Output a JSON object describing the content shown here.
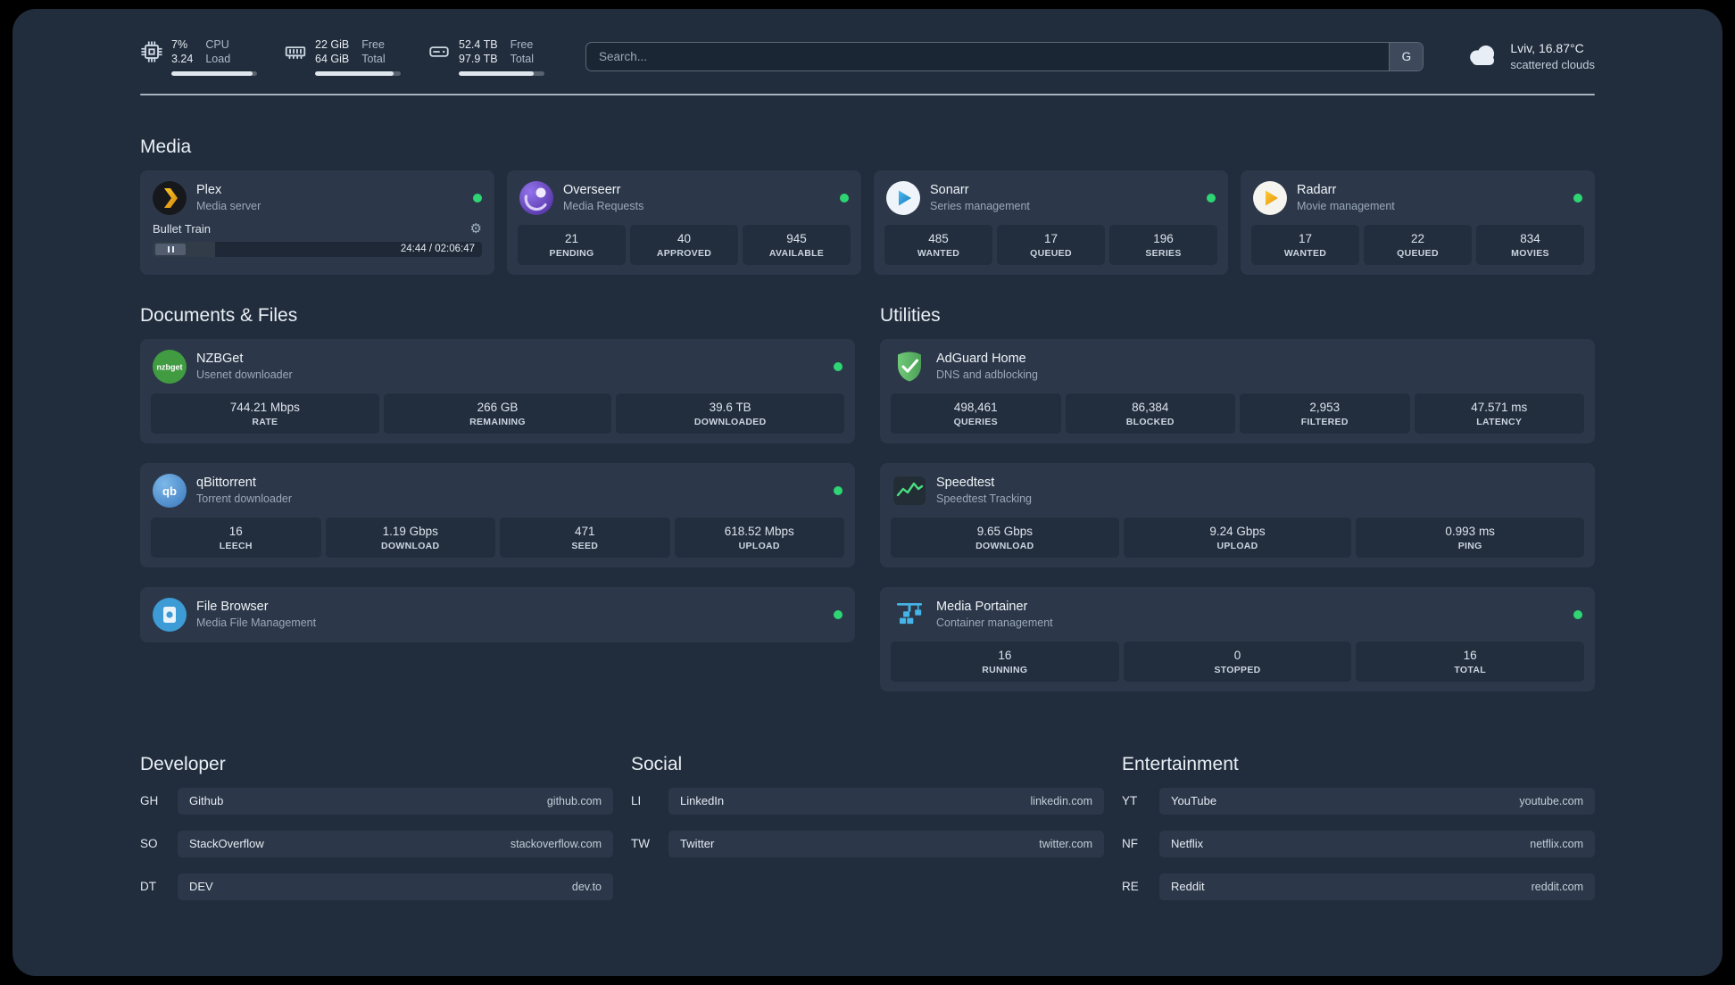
{
  "colors": {
    "status_online": "#2ed573",
    "plex_accent": "#e5a00d",
    "adguard_green": "#68bc71",
    "speedtest_line": "#4ade80"
  },
  "topbar": {
    "resources": [
      {
        "icon": "cpu-icon",
        "primary": "7%",
        "secondary": "3.24",
        "label_primary": "CPU",
        "label_secondary": "Load"
      },
      {
        "icon": "memory-icon",
        "primary": "22 GiB",
        "secondary": "64 GiB",
        "label_primary": "Free",
        "label_secondary": "Total"
      },
      {
        "icon": "disk-icon",
        "primary": "52.4 TB",
        "secondary": "97.9 TB",
        "label_primary": "Free",
        "label_secondary": "Total"
      }
    ],
    "search": {
      "placeholder": "Search...",
      "provider_button": "G"
    },
    "weather": {
      "icon": "cloud-icon",
      "location": "Lviv, 16.87°C",
      "condition": "scattered clouds"
    }
  },
  "sections": {
    "media": {
      "title": "Media",
      "cards": [
        {
          "name": "Plex",
          "subtitle": "Media server",
          "icon": "plex-icon",
          "online": true,
          "player": {
            "track": "Bullet Train",
            "time": "24:44 / 02:06:47",
            "controls": [
              "gear-icon",
              "pause-icon"
            ]
          }
        },
        {
          "name": "Overseerr",
          "subtitle": "Media Requests",
          "icon": "overseerr-icon",
          "online": true,
          "stats": [
            {
              "value": "21",
              "label": "PENDING"
            },
            {
              "value": "40",
              "label": "APPROVED"
            },
            {
              "value": "945",
              "label": "AVAILABLE"
            }
          ]
        },
        {
          "name": "Sonarr",
          "subtitle": "Series management",
          "icon": "sonarr-icon",
          "online": true,
          "stats": [
            {
              "value": "485",
              "label": "WANTED"
            },
            {
              "value": "17",
              "label": "QUEUED"
            },
            {
              "value": "196",
              "label": "SERIES"
            }
          ]
        },
        {
          "name": "Radarr",
          "subtitle": "Movie management",
          "icon": "radarr-icon",
          "online": true,
          "stats": [
            {
              "value": "17",
              "label": "WANTED"
            },
            {
              "value": "22",
              "label": "QUEUED"
            },
            {
              "value": "834",
              "label": "MOVIES"
            }
          ]
        }
      ]
    },
    "documents": {
      "title": "Documents & Files",
      "cards": [
        {
          "name": "NZBGet",
          "subtitle": "Usenet downloader",
          "icon": "nzbget-icon",
          "online": true,
          "stats": [
            {
              "value": "744.21 Mbps",
              "label": "RATE"
            },
            {
              "value": "266 GB",
              "label": "REMAINING"
            },
            {
              "value": "39.6 TB",
              "label": "DOWNLOADED"
            }
          ]
        },
        {
          "name": "qBittorrent",
          "subtitle": "Torrent downloader",
          "icon": "qbittorrent-icon",
          "online": true,
          "stats": [
            {
              "value": "16",
              "label": "LEECH"
            },
            {
              "value": "1.19 Gbps",
              "label": "DOWNLOAD"
            },
            {
              "value": "471",
              "label": "SEED"
            },
            {
              "value": "618.52 Mbps",
              "label": "UPLOAD"
            }
          ]
        },
        {
          "name": "File Browser",
          "subtitle": "Media File Management",
          "icon": "filebrowser-icon",
          "online": true,
          "stats": []
        }
      ]
    },
    "utilities": {
      "title": "Utilities",
      "cards": [
        {
          "name": "AdGuard Home",
          "subtitle": "DNS and adblocking",
          "icon": "adguard-icon",
          "online": false,
          "stats": [
            {
              "value": "498,461",
              "label": "QUERIES"
            },
            {
              "value": "86,384",
              "label": "BLOCKED"
            },
            {
              "value": "2,953",
              "label": "FILTERED"
            },
            {
              "value": "47.571 ms",
              "label": "LATENCY"
            }
          ]
        },
        {
          "name": "Speedtest",
          "subtitle": "Speedtest Tracking",
          "icon": "speedtest-icon",
          "online": false,
          "stats": [
            {
              "value": "9.65 Gbps",
              "label": "DOWNLOAD"
            },
            {
              "value": "9.24 Gbps",
              "label": "UPLOAD"
            },
            {
              "value": "0.993 ms",
              "label": "PING"
            }
          ]
        },
        {
          "name": "Media Portainer",
          "subtitle": "Container management",
          "icon": "portainer-icon",
          "online": true,
          "stats": [
            {
              "value": "16",
              "label": "RUNNING"
            },
            {
              "value": "0",
              "label": "STOPPED"
            },
            {
              "value": "16",
              "label": "TOTAL"
            }
          ]
        }
      ]
    }
  },
  "bookmarks": [
    {
      "title": "Developer",
      "items": [
        {
          "abbr": "GH",
          "name": "Github",
          "domain": "github.com"
        },
        {
          "abbr": "SO",
          "name": "StackOverflow",
          "domain": "stackoverflow.com"
        },
        {
          "abbr": "DT",
          "name": "DEV",
          "domain": "dev.to"
        }
      ]
    },
    {
      "title": "Social",
      "items": [
        {
          "abbr": "LI",
          "name": "LinkedIn",
          "domain": "linkedin.com"
        },
        {
          "abbr": "TW",
          "name": "Twitter",
          "domain": "twitter.com"
        }
      ]
    },
    {
      "title": "Entertainment",
      "items": [
        {
          "abbr": "YT",
          "name": "YouTube",
          "domain": "youtube.com"
        },
        {
          "abbr": "NF",
          "name": "Netflix",
          "domain": "netflix.com"
        },
        {
          "abbr": "RE",
          "name": "Reddit",
          "domain": "reddit.com"
        }
      ]
    }
  ]
}
